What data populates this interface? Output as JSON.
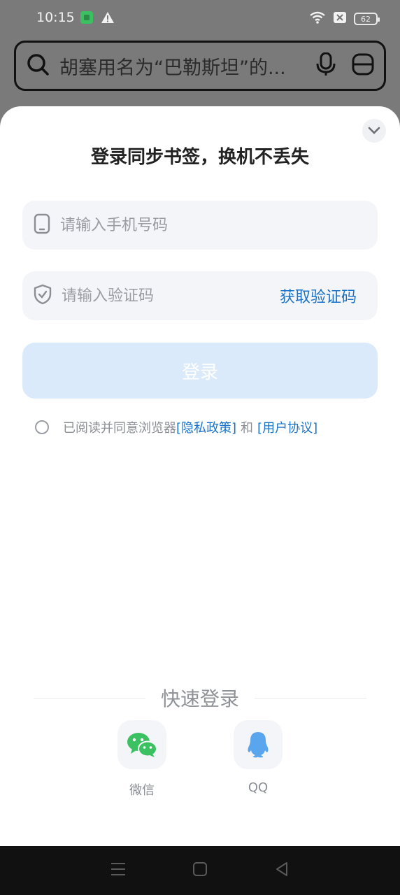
{
  "status_bar": {
    "time": "10:15",
    "battery": "62",
    "icons": [
      "sim-card-icon",
      "warning-icon",
      "wifi-icon",
      "data-off-icon",
      "battery-icon"
    ]
  },
  "search": {
    "query": "胡塞用名为“巴勒斯坦”的...",
    "icons": [
      "search-icon",
      "microphone-icon",
      "scan-icon"
    ]
  },
  "login_sheet": {
    "title": "登录同步书签，换机不丢失",
    "phone_placeholder": "请输入手机号码",
    "code_placeholder": "请输入验证码",
    "get_code_label": "获取验证码",
    "login_label": "登录",
    "agreement": {
      "prefix": "已阅读并同意浏览器",
      "privacy": "[隐私政策]",
      "and": "和",
      "terms": "[用户协议]"
    },
    "quick_login": {
      "title": "快速登录",
      "options": [
        {
          "label": "微信",
          "icon": "wechat-icon"
        },
        {
          "label": "QQ",
          "icon": "qq-icon"
        }
      ]
    }
  },
  "colors": {
    "accent": "#1a73c8",
    "login_disabled": "#dbeafa",
    "wechat_green": "#3cc162",
    "qq_blue": "#5aa6ee"
  }
}
